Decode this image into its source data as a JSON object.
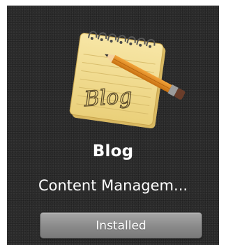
{
  "app": {
    "name": "Blog",
    "description": "Content Managem...",
    "icon": "notepad-pencil-icon",
    "icon_text": "Blog"
  },
  "button": {
    "label": "Installed"
  },
  "colors": {
    "tile_background": "#2d2d2d",
    "text": "#ffffff",
    "button": "#8a8a8a",
    "notepad": "#f3dc8e",
    "pencil": "#e08a1f"
  }
}
